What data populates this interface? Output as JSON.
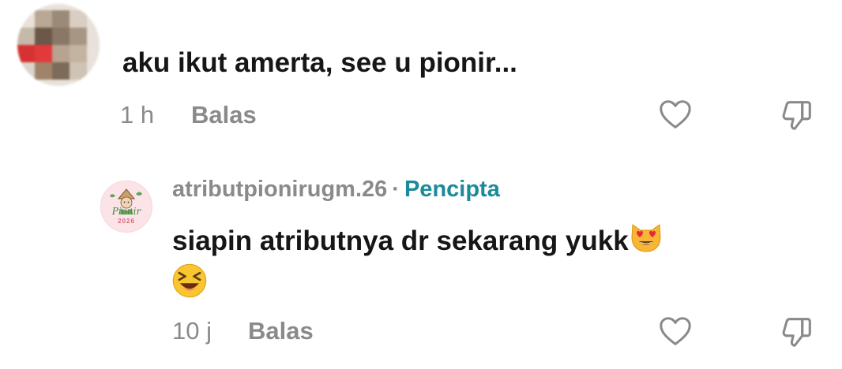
{
  "comment1": {
    "text": "aku ikut amerta, see u pionir...",
    "time": "1 h",
    "reply_label": "Balas"
  },
  "reply1": {
    "username": "atributpionirugm.26",
    "separator": "·",
    "creator_badge": "Pencipta",
    "text_line1": "siapin atributnya dr sekarang yukk",
    "time": "10 j",
    "reply_label": "Balas",
    "avatar_text": "Pionir",
    "avatar_year": "2026"
  },
  "icons": {
    "like": "heart-outline-icon",
    "dislike": "thumbs-down-outline-icon",
    "emoji1": "heart-eyes-cat-emoji",
    "emoji2": "squinting-laugh-emoji"
  },
  "colors": {
    "text": "#161616",
    "meta": "#8a8a8a",
    "creator": "#1b8a99"
  }
}
